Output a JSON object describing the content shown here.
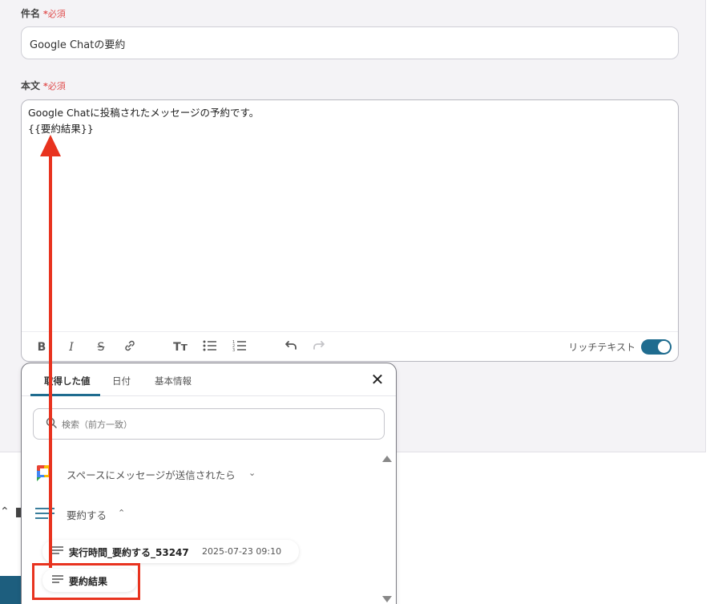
{
  "subject": {
    "label": "件名",
    "required_star": "*",
    "required_text": "必須",
    "value": "Google Chatの要約"
  },
  "body": {
    "label": "本文",
    "required_star": "*",
    "required_text": "必須",
    "line1": "Google Chatに投稿されたメッセージの予約です。",
    "line2": "{{要約結果}}"
  },
  "toolbar": {
    "rich_text_label": "リッチテキスト",
    "rich_text_enabled": true
  },
  "popover": {
    "tabs": [
      "取得した値",
      "日付",
      "基本情報"
    ],
    "active_tab": "取得した値",
    "search_placeholder": "検索（前方一致）",
    "groups": [
      {
        "title": "スペースにメッセージが送信されたら",
        "expanded": false,
        "icon": "google-chat-icon"
      },
      {
        "title": "要約する",
        "expanded": true,
        "icon": "lines-icon"
      }
    ],
    "items": [
      {
        "name": "実行時間_要約する_53247",
        "value": "2025-07-23 09:10"
      },
      {
        "name": "要約結果",
        "value": ""
      }
    ]
  },
  "colors": {
    "accent": "#1f6c8f",
    "required": "#e05050",
    "annotation": "#e8331f"
  }
}
